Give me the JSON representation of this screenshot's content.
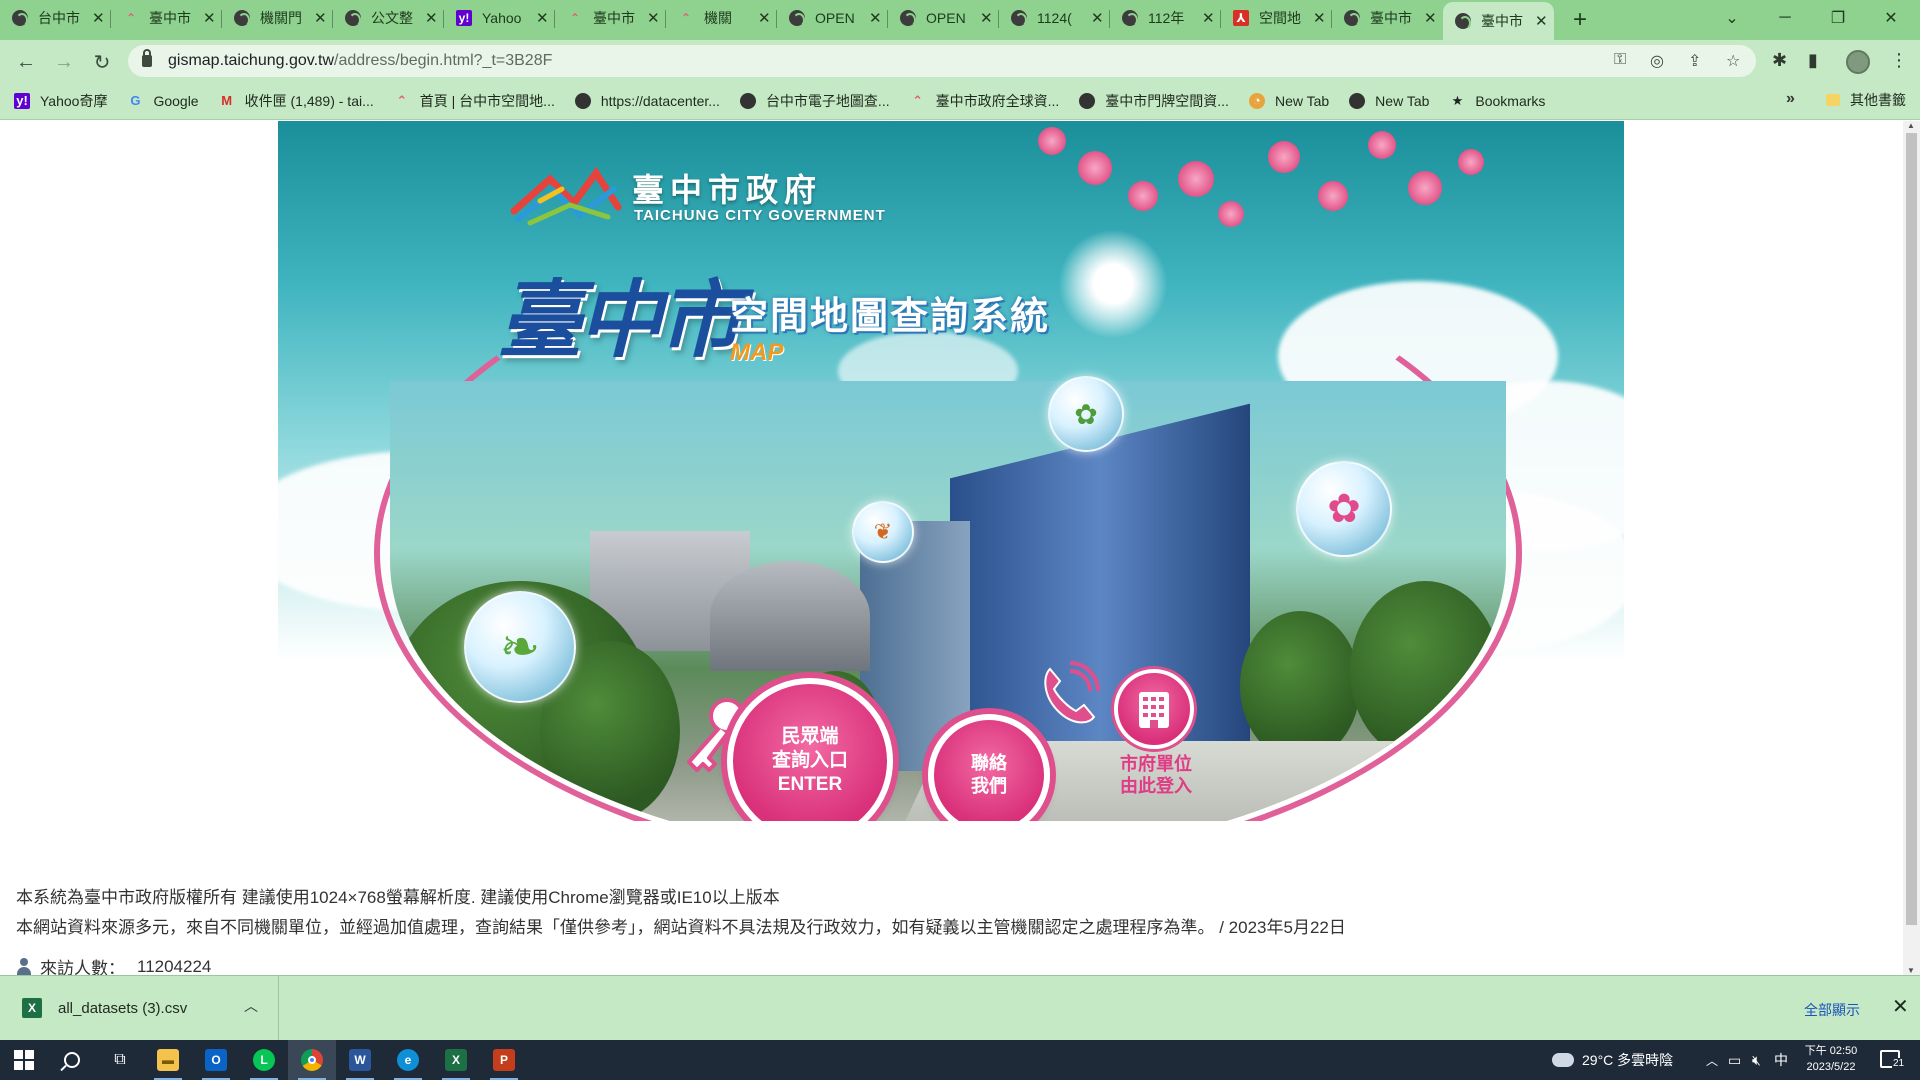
{
  "browser": {
    "tabs": [
      {
        "title": "台中市",
        "favicon": "globe-icon"
      },
      {
        "title": "臺中市",
        "favicon": "taichung-logo-icon"
      },
      {
        "title": "機關門",
        "favicon": "globe-icon"
      },
      {
        "title": "公文整",
        "favicon": "globe-icon"
      },
      {
        "title": "Yahoo",
        "favicon": "yahoo-icon"
      },
      {
        "title": "臺中市",
        "favicon": "taichung-logo-icon"
      },
      {
        "title": "機關",
        "favicon": "taichung-logo-icon"
      },
      {
        "title": "OPEN",
        "favicon": "globe-icon"
      },
      {
        "title": "OPEN",
        "favicon": "globe-icon"
      },
      {
        "title": "1124(",
        "favicon": "globe-icon"
      },
      {
        "title": "112年",
        "favicon": "globe-icon"
      },
      {
        "title": "空間地",
        "favicon": "pdf-icon"
      },
      {
        "title": "臺中市",
        "favicon": "globe-icon"
      },
      {
        "title": "臺中市",
        "favicon": "globe-icon",
        "active": true
      }
    ],
    "url_host": "gismap.taichung.gov.tw",
    "url_path": "/address/begin.html?_t=3B28F",
    "bookmarks": [
      {
        "label": "Yahoo奇摩",
        "icon": "yahoo-icon"
      },
      {
        "label": "Google",
        "icon": "google-icon"
      },
      {
        "label": "收件匣 (1,489) - tai...",
        "icon": "gmail-icon"
      },
      {
        "label": "首頁 | 台中市空間地...",
        "icon": "taichung-logo-icon"
      },
      {
        "label": "https://datacenter...",
        "icon": "globe-icon"
      },
      {
        "label": "台中市電子地圖查...",
        "icon": "globe-icon"
      },
      {
        "label": "臺中市政府全球資...",
        "icon": "taichung-logo-icon"
      },
      {
        "label": "臺中市門牌空間資...",
        "icon": "globe-icon"
      },
      {
        "label": "New Tab",
        "icon": "new-tab-icon"
      },
      {
        "label": "New Tab",
        "icon": "globe-icon"
      },
      {
        "label": "Bookmarks",
        "icon": "star-icon"
      }
    ],
    "bookmarks_more": "»",
    "other_bookmarks": "其他書籤"
  },
  "page": {
    "gov_name_zh": "臺中市政府",
    "gov_name_en": "TAICHUNG CITY GOVERNMENT",
    "city_title": "臺中市",
    "system_title": "空間地圖查詢系統",
    "map_tag": "MAP",
    "enter_button": {
      "line1": "民眾端",
      "line2": "查詢入口",
      "line3": "ENTER"
    },
    "contact_button": {
      "line1": "聯絡",
      "line2": "我們"
    },
    "office_login": {
      "line1": "市府單位",
      "line2": "由此登入"
    },
    "notice_line1": "本系統為臺中市政府版權所有 建議使用1024×768螢幕解析度. 建議使用Chrome瀏覽器或IE10以上版本",
    "notice_line2": "本網站資料來源多元，來自不同機關單位，並經過加值處理，查詢結果「僅供參考」，網站資料不具法規及行政效力，如有疑義以主管機關認定之處理程序為準。 / 2023年5月22日",
    "visitor_label": "來訪人數：",
    "visitor_count": "11204224"
  },
  "download_bar": {
    "file_name": "all_datasets (3).csv",
    "show_all": "全部顯示"
  },
  "taskbar": {
    "weather": "29°C  多雲時陰",
    "ime": "中",
    "time": "下午 02:50",
    "date": "2023/5/22",
    "notification_count": "21"
  },
  "colors": {
    "chrome_green": "#8fd18f",
    "toolbar_green": "#c5e8c5",
    "accent_pink": "#e04f8d",
    "title_blue": "#1b4f9e",
    "taskbar": "#1e2a38"
  }
}
